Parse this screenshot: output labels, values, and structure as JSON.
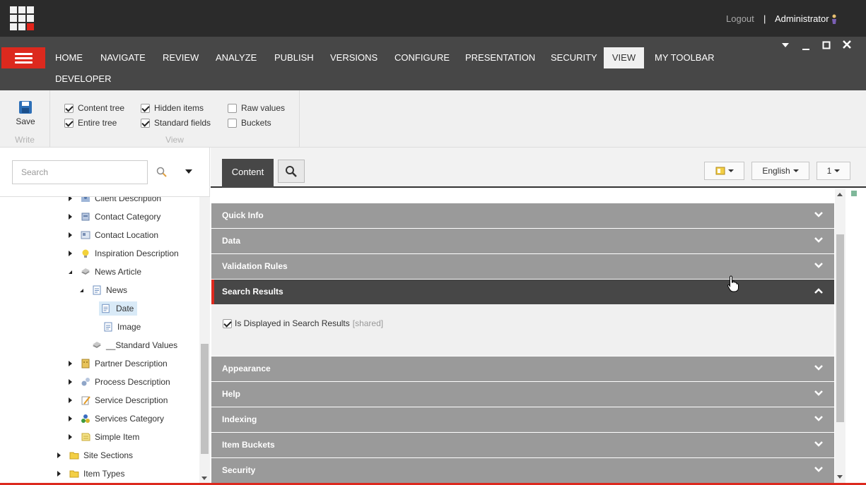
{
  "header": {
    "logout_label": "Logout",
    "separator": "|",
    "user_name": "Administrator"
  },
  "nav": {
    "tabs": [
      {
        "label": "HOME"
      },
      {
        "label": "NAVIGATE"
      },
      {
        "label": "REVIEW"
      },
      {
        "label": "ANALYZE"
      },
      {
        "label": "PUBLISH"
      },
      {
        "label": "VERSIONS"
      },
      {
        "label": "CONFIGURE"
      },
      {
        "label": "PRESENTATION"
      },
      {
        "label": "SECURITY"
      },
      {
        "label": "VIEW",
        "active": true
      },
      {
        "label": "MY TOOLBAR"
      },
      {
        "label": "DEVELOPER"
      }
    ]
  },
  "ribbon": {
    "save_label": "Save",
    "write_caption": "Write",
    "view_caption": "View",
    "options": [
      {
        "label": "Content tree",
        "checked": true
      },
      {
        "label": "Entire tree",
        "checked": true
      },
      {
        "label": "Hidden items",
        "checked": true
      },
      {
        "label": "Standard fields",
        "checked": true
      },
      {
        "label": "Raw values",
        "checked": false
      },
      {
        "label": "Buckets",
        "checked": false
      }
    ]
  },
  "search": {
    "placeholder": "Search"
  },
  "tree": {
    "nodes": [
      {
        "label": "Client Description",
        "icon": "client-icon",
        "expander": "collapsed"
      },
      {
        "label": "Contact Category",
        "icon": "contact-category-icon",
        "expander": "collapsed"
      },
      {
        "label": "Contact Location",
        "icon": "contact-location-icon",
        "expander": "collapsed"
      },
      {
        "label": "Inspiration Description",
        "icon": "lightbulb-icon",
        "expander": "collapsed"
      },
      {
        "label": "News Article",
        "icon": "template-icon",
        "expander": "expanded"
      },
      {
        "label": "News",
        "icon": "document-icon",
        "expander": "expanded"
      },
      {
        "label": "Date",
        "icon": "document-icon",
        "expander": "none",
        "selected": true
      },
      {
        "label": "Image",
        "icon": "document-icon",
        "expander": "none"
      },
      {
        "label": "__Standard Values",
        "icon": "template-icon",
        "expander": "none"
      },
      {
        "label": "Partner Description",
        "icon": "partner-icon",
        "expander": "collapsed"
      },
      {
        "label": "Process Description",
        "icon": "process-icon",
        "expander": "collapsed"
      },
      {
        "label": "Service Description",
        "icon": "service-icon",
        "expander": "collapsed"
      },
      {
        "label": "Services Category",
        "icon": "services-category-icon",
        "expander": "collapsed"
      },
      {
        "label": "Simple Item",
        "icon": "simple-item-icon",
        "expander": "collapsed"
      },
      {
        "label": "Site Sections",
        "icon": "folder-icon",
        "expander": "collapsed"
      },
      {
        "label": "Item Types",
        "icon": "folder-icon",
        "expander": "collapsed"
      }
    ]
  },
  "editor": {
    "content_tab": "Content",
    "language": "English",
    "version": "1",
    "sections": [
      {
        "label": "Quick Info"
      },
      {
        "label": "Data"
      },
      {
        "label": "Validation Rules"
      },
      {
        "label": "Search Results",
        "expanded": true
      },
      {
        "label": "Appearance"
      },
      {
        "label": "Help"
      },
      {
        "label": "Indexing"
      },
      {
        "label": "Item Buckets"
      },
      {
        "label": "Security"
      }
    ],
    "field": {
      "label": "Is Displayed in Search Results",
      "shared_tag": "[shared]",
      "checked": true
    }
  },
  "colors": {
    "accent_red": "#dc291e",
    "topbar": "#2b2b2b",
    "nav_bar": "#474747",
    "section_header": "#9a9a9a"
  }
}
